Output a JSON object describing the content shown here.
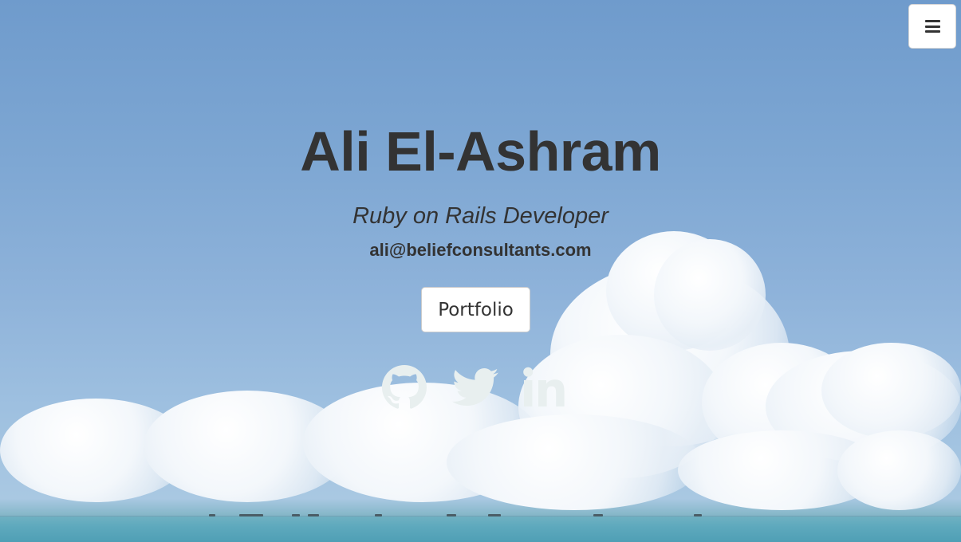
{
  "header": {
    "menu_icon": "hamburger-icon"
  },
  "hero": {
    "name": "Ali El-Ashram",
    "role": "Ruby on Rails Developer",
    "email": "ali@beliefconsultants.com",
    "portfolio_label": "Portfolio"
  },
  "social": [
    {
      "icon": "github-icon"
    },
    {
      "icon": "twitter-icon"
    },
    {
      "icon": "linkedin-icon"
    }
  ],
  "colors": {
    "text": "#333333",
    "icon": "#e6eeee",
    "button_bg": "#ffffff"
  }
}
